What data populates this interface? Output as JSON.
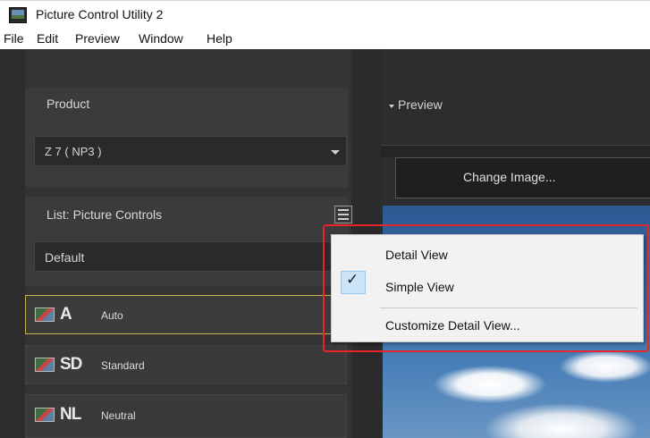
{
  "window": {
    "title": "Picture Control Utility 2"
  },
  "menubar": {
    "items": [
      "File",
      "Edit",
      "Preview",
      "Window",
      "Help"
    ]
  },
  "product": {
    "label": "Product",
    "selected": "Z 7 ( NP3 )"
  },
  "list": {
    "label": "List: Picture Controls",
    "filter_selected": "Default",
    "items": [
      {
        "code": "A",
        "name": "Auto"
      },
      {
        "code": "SD",
        "name": "Standard"
      },
      {
        "code": "NL",
        "name": "Neutral"
      }
    ]
  },
  "preview": {
    "title": "Preview",
    "change_button": "Change Image..."
  },
  "context_menu": {
    "items": [
      "Detail View",
      "Simple View",
      "Customize Detail View..."
    ],
    "checked": "Simple View",
    "check_glyph": "✓"
  },
  "colors": {
    "highlight": "#e5262c",
    "selected_border": "#c8b44a",
    "check_bg": "#cce4f7"
  }
}
